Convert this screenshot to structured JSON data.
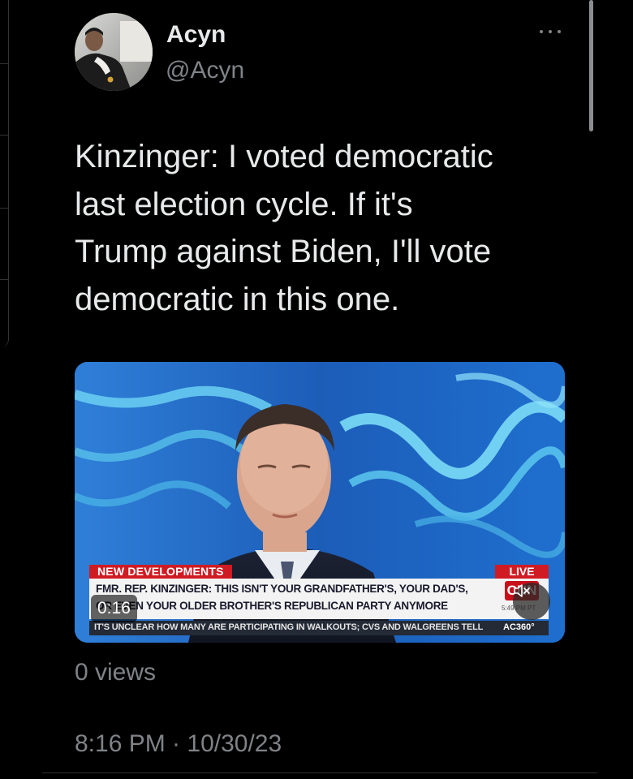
{
  "tweet": {
    "display_name": "Acyn",
    "handle": "@Acyn",
    "text_lines": [
      "Kinzinger: I voted democratic",
      "last election cycle. If it's",
      "Trump against Biden, I'll vote",
      "democratic in this one."
    ],
    "views": "0 views",
    "datetime": "8:16 PM · 10/30/23"
  },
  "video": {
    "timestamp": "0:16",
    "lower_third": {
      "tag": "NEW DEVELOPMENTS",
      "live": "LIVE",
      "headline_line1": "FMR. REP. KINZINGER: THIS ISN'T YOUR GRANDFATHER'S, YOUR DAD'S,",
      "headline_line2": "OR EVEN YOUR OLDER BROTHER'S REPUBLICAN PARTY ANYMORE",
      "network": "CNN",
      "clock": "5:49 PM PT",
      "ticker": "IT'S UNCLEAR HOW MANY ARE PARTICIPATING IN WALKOUTS; CVS AND WALGREENS TELL",
      "show": "AC360°"
    }
  },
  "icons": {
    "more": "more-horizontal-icon",
    "mute": "speaker-muted-icon"
  },
  "colors": {
    "background": "#000000",
    "primary_text": "#e7e9ea",
    "secondary_text": "#7f8387",
    "cnn_red": "#d11b23"
  }
}
